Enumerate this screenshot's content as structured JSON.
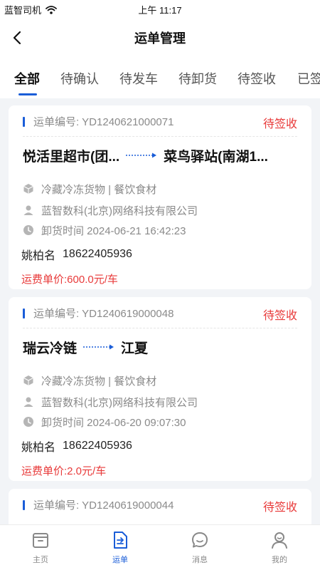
{
  "status_bar": {
    "carrier": "蓝智司机",
    "time": "上午 11:17"
  },
  "header": {
    "title": "运单管理"
  },
  "tabs": [
    {
      "label": "全部",
      "active": true
    },
    {
      "label": "待确认"
    },
    {
      "label": "待发车"
    },
    {
      "label": "待卸货"
    },
    {
      "label": "待签收"
    },
    {
      "label": "已签"
    }
  ],
  "orders": [
    {
      "no_label": "运单编号:",
      "no": "YD1240621000071",
      "status": "待签收",
      "from": "悦活里超市(团...",
      "to": "菜鸟驿站(南湖1...",
      "goods": "冷藏冷冻货物 | 餐饮食材",
      "company": "蓝智数科(北京)网络科技有限公司",
      "unload_time": "卸货时间 2024-06-21 16:42:23",
      "driver": "姚柏名",
      "phone": "18622405936",
      "price": "运费单价:600.0元/车"
    },
    {
      "no_label": "运单编号:",
      "no": "YD1240619000048",
      "status": "待签收",
      "from": "瑞云冷链",
      "to": "江夏",
      "goods": "冷藏冷冻货物 | 餐饮食材",
      "company": "蓝智数科(北京)网络科技有限公司",
      "unload_time": "卸货时间 2024-06-20 09:07:30",
      "driver": "姚柏名",
      "phone": "18622405936",
      "price": "运费单价:2.0元/车"
    },
    {
      "no_label": "运单编号:",
      "no": "YD1240619000044",
      "status": "待签收"
    }
  ],
  "tab_bar": [
    {
      "label": "主页",
      "icon": "home-box-icon"
    },
    {
      "label": "运单",
      "icon": "waybill-icon",
      "active": true
    },
    {
      "label": "消息",
      "icon": "message-icon"
    },
    {
      "label": "我的",
      "icon": "profile-icon"
    }
  ],
  "colors": {
    "accent": "#1a5dd8",
    "status_red": "#e83a3a",
    "muted": "#8a8a8a",
    "background": "#f2f4f7"
  }
}
